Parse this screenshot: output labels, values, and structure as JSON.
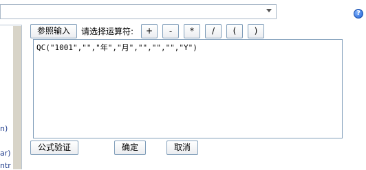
{
  "top_select": {
    "value": ""
  },
  "help_icon": "?",
  "left_panel": {
    "fragments": [
      "n)",
      "ar)",
      "ntr"
    ]
  },
  "toolbar": {
    "reference_input_label": "参照输入",
    "operator_prompt": "请选择运算符:",
    "operators": [
      "+",
      "-",
      "*",
      "/",
      "(",
      ")"
    ]
  },
  "formula": {
    "value": "QC(\"1001\",\"\",\"年\",\"月\",\"\",\"\",\"\",\"Y\")"
  },
  "footer": {
    "validate_label": "公式验证",
    "ok_label": "确定",
    "cancel_label": "取消"
  }
}
